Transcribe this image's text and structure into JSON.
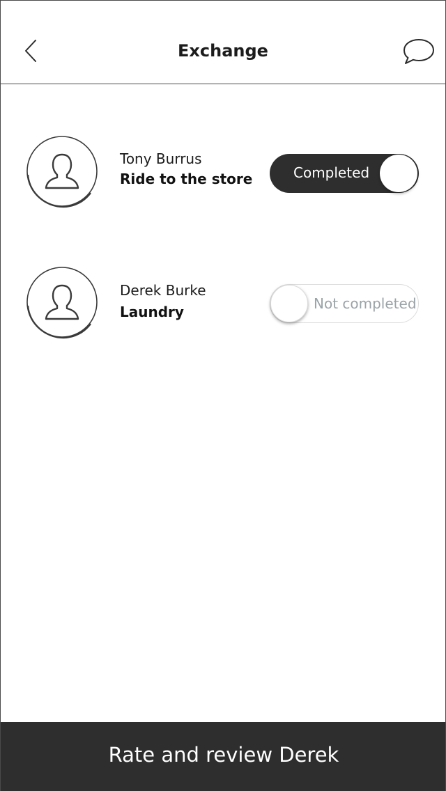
{
  "header": {
    "title": "Exchange",
    "back_icon": "chevron-left-icon",
    "chat_icon": "speech-bubble-icon"
  },
  "exchanges": [
    {
      "avatar_icon": "user-icon",
      "name": "Tony Burrus",
      "task": "Ride to the store",
      "status_label": "Completed",
      "completed": true
    },
    {
      "avatar_icon": "user-icon",
      "name": "Derek Burke",
      "task": "Laundry",
      "status_label": "Not completed",
      "completed": false
    }
  ],
  "footer": {
    "button_label": "Rate and review Derek"
  },
  "colors": {
    "dark": "#2e2e2e",
    "muted_text": "#9aa3a8",
    "border": "#4a4a4a"
  }
}
